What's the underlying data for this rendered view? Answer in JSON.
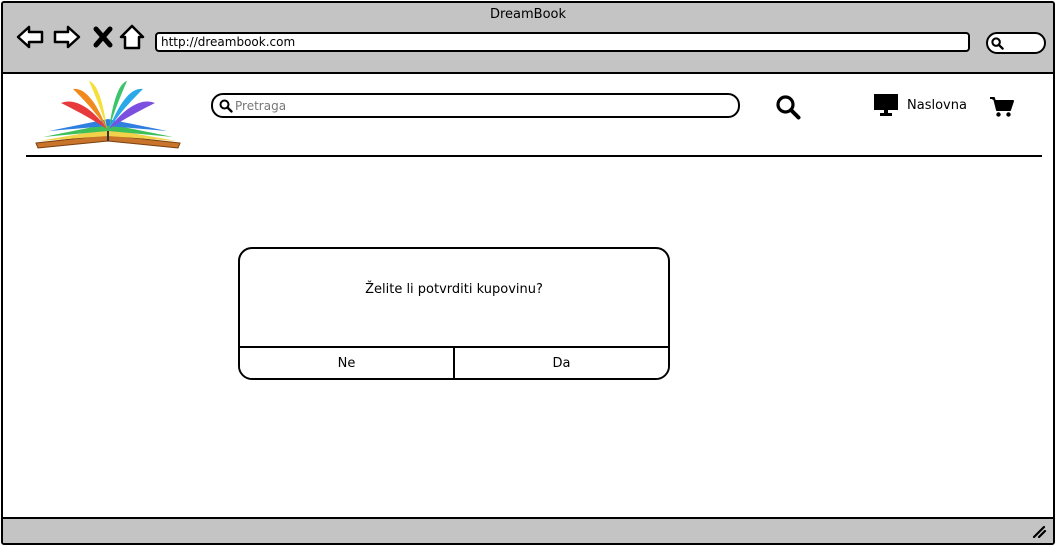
{
  "window": {
    "title": "DreamBook"
  },
  "browser": {
    "url": "http://dreambook.com",
    "back_icon": "arrow-left-icon",
    "forward_icon": "arrow-right-icon",
    "stop_icon": "close-icon",
    "home_icon": "home-icon"
  },
  "header": {
    "logo": "open-book-rainbow-logo",
    "search": {
      "placeholder": "Pretraga"
    },
    "home_label": "Naslovna"
  },
  "dialog": {
    "message": "Želite li potvrditi kupovinu?",
    "no_label": "Ne",
    "yes_label": "Da"
  },
  "colors": {
    "chrome": "#c4c4c4",
    "outline": "#000000"
  }
}
